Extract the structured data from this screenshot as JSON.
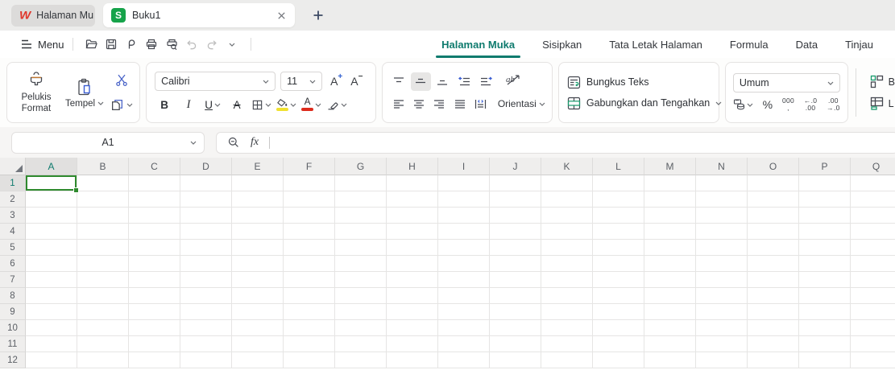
{
  "colors": {
    "accent_teal": "#0f7b6e",
    "selection_green": "#2f8a2e",
    "logo_red": "#e0362c",
    "sheet_green": "#16a34a",
    "icon_blue": "#4a64c8",
    "font_color_red": "#dd2b1c",
    "fill_yellow": "#f0e130"
  },
  "tabbar": {
    "home_tab_label": "Halaman Mu",
    "doc_tab_label": "Buku1",
    "doc_tab_icon": "S",
    "wps_logo": "W"
  },
  "menubar": {
    "menu_label": "Menu",
    "toolbar_icons": [
      "open-file",
      "save",
      "output",
      "print",
      "print-preview",
      "undo",
      "redo",
      "more-commands"
    ]
  },
  "ribbon_tabs": [
    {
      "label": "Halaman Muka",
      "active": true
    },
    {
      "label": "Sisipkan",
      "active": false
    },
    {
      "label": "Tata Letak Halaman",
      "active": false
    },
    {
      "label": "Formula",
      "active": false
    },
    {
      "label": "Data",
      "active": false
    },
    {
      "label": "Tinjau",
      "active": false
    }
  ],
  "ribbon": {
    "clipboard": {
      "format_painter": "Pelukis Format",
      "paste": "Tempel"
    },
    "font": {
      "family": "Calibri",
      "size": "11",
      "bold": "B",
      "italic": "I",
      "underline": "U",
      "strikethrough": "A",
      "grow_letter": "A",
      "grow_sign": "+",
      "shrink_letter": "A",
      "shrink_sign": "−"
    },
    "alignment": {
      "orientation": "Orientasi",
      "orientation_glyph": "ab"
    },
    "wrap_merge": {
      "wrap": "Bungkus Teks",
      "merge": "Gabungkan dan Tengahkan"
    },
    "number": {
      "format": "Umum",
      "percent": "%",
      "thousands_top": "000",
      "thousands_bottom": ",",
      "dec_decrease_top": "←.0",
      "dec_decrease_bottom": ".00",
      "dec_increase_top": ".00",
      "dec_increase_bottom": "→.0"
    },
    "cells_partial": {
      "row1_label": "B",
      "row2_label": "L"
    }
  },
  "formula_bar": {
    "cell_ref": "A1",
    "fx": "fx",
    "formula_value": ""
  },
  "grid": {
    "columns": [
      "A",
      "B",
      "C",
      "D",
      "E",
      "F",
      "G",
      "H",
      "I",
      "J",
      "K",
      "L",
      "M",
      "N",
      "O",
      "P",
      "Q"
    ],
    "rows": [
      "1",
      "2",
      "3",
      "4",
      "5",
      "6",
      "7",
      "8",
      "9",
      "10",
      "11",
      "12"
    ],
    "selected_cell": "A1",
    "selected_column": "A",
    "selected_row": "1"
  }
}
